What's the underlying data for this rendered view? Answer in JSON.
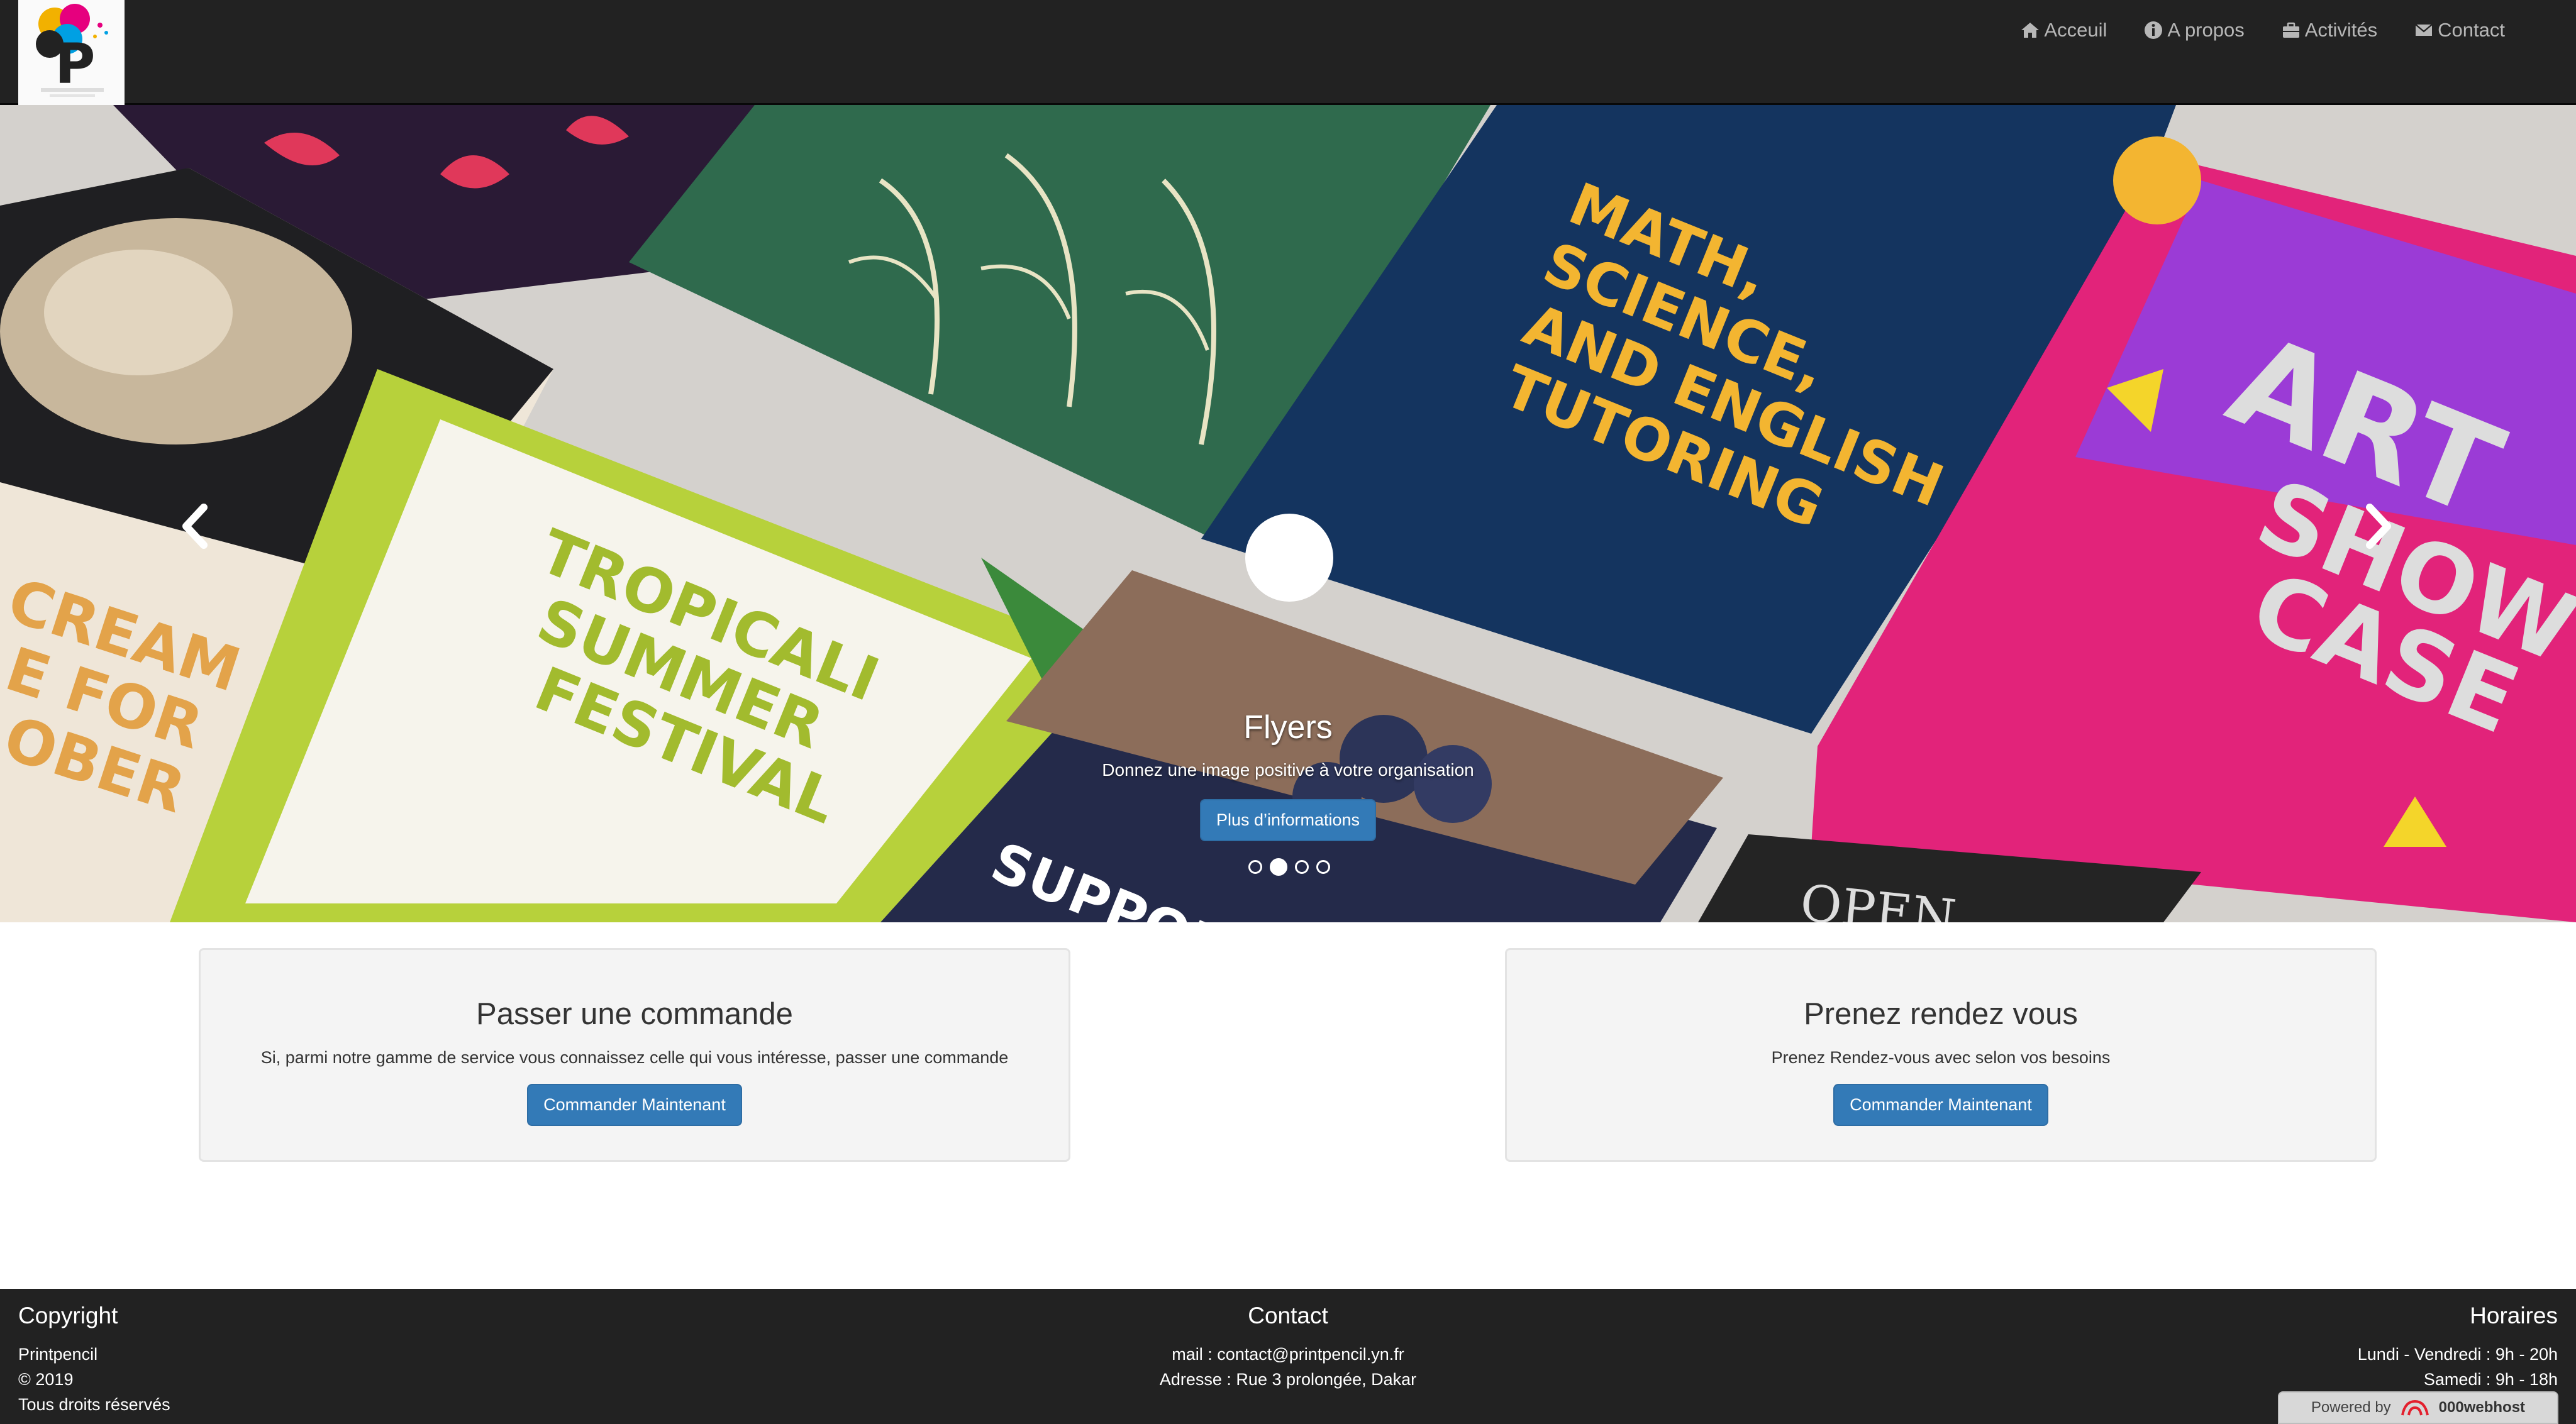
{
  "brand": {
    "logo_icon": "printpencil-logo"
  },
  "nav": {
    "items": [
      {
        "label": "Acceuil",
        "icon": "home-icon"
      },
      {
        "label": "A propos",
        "icon": "info-icon"
      },
      {
        "label": "Activités",
        "icon": "briefcase-icon"
      },
      {
        "label": "Contact",
        "icon": "envelope-icon"
      }
    ]
  },
  "carousel": {
    "caption_title": "Flyers",
    "caption_text": "Donnez une image positive à votre organisation",
    "button_label": "Plus d’informations",
    "slide_count": 4,
    "active_slide": 2,
    "prev_icon": "chevron-left-icon",
    "next_icon": "chevron-right-icon"
  },
  "panels": [
    {
      "title": "Passer une commande",
      "text": "Si, parmi notre gamme de service vous connaissez celle qui vous intéresse, passer une commande",
      "button_label": "Commander Maintenant"
    },
    {
      "title": "Prenez rendez vous",
      "text": "Prenez Rendez-vous avec selon vos besoins",
      "button_label": "Commander Maintenant"
    }
  ],
  "footer": {
    "copyright": {
      "title": "Copyright",
      "lines": [
        "Printpencil",
        "© 2019",
        "Tous droits réservés"
      ]
    },
    "contact": {
      "title": "Contact",
      "lines": [
        "mail : contact@printpencil.yn.fr",
        "Adresse : Rue 3 prolongée, Dakar"
      ]
    },
    "hours": {
      "title": "Horaires",
      "lines": [
        "Lundi - Vendredi : 9h - 20h",
        "Samedi : 9h - 18h"
      ]
    }
  },
  "badge": {
    "prefix": "Powered by",
    "brand": "000webhost"
  },
  "colors": {
    "navbar": "#222222",
    "primary": "#337ab7",
    "panel_bg": "#f4f4f4",
    "footer": "#222222"
  }
}
